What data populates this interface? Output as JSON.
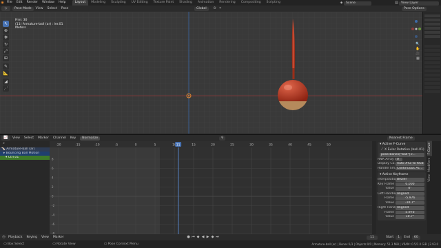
{
  "topbar": {
    "menus": [
      "File",
      "Edit",
      "Render",
      "Window",
      "Help"
    ],
    "workspaces": [
      "Layout",
      "Modeling",
      "Sculpting",
      "UV Editing",
      "Texture Paint",
      "Shading",
      "Animation",
      "Rendering",
      "Compositing",
      "Scripting"
    ],
    "active_workspace": "Layout",
    "scene": "Scene",
    "view_layer": "View Layer"
  },
  "viewport_header": {
    "mode": "Pose Mode",
    "menus": [
      "View",
      "Select",
      "Pose"
    ],
    "transform": "Global",
    "options": "Pose Options"
  },
  "viewport_overlay": {
    "line1": "Frm: 30",
    "line2": "(11) Armature-ball (ar) : ler.01",
    "line3": "Meters"
  },
  "toolbar": {
    "tools": [
      "select-box",
      "cursor",
      "move",
      "rotate",
      "scale",
      "transform",
      "annotate",
      "measure",
      "pose-relax",
      "pose-breakdown"
    ]
  },
  "graph_header": {
    "menus": [
      "View",
      "Select",
      "Marker",
      "Channel",
      "Key"
    ],
    "normalize": "Normalize",
    "snap": "Nearest Frame"
  },
  "frame_ruler": [
    "-20",
    "-15",
    "-10",
    "-5",
    "0",
    "5",
    "10",
    "15",
    "20",
    "25",
    "30",
    "35",
    "40",
    "45",
    "50"
  ],
  "current_frame": "11",
  "channels": [
    {
      "label": "Armature-ball (ar)",
      "level": 0
    },
    {
      "label": "Bouncing Ball Motion",
      "level": 1
    },
    {
      "label": "Ctrl.01",
      "level": 2
    }
  ],
  "y_ticks": [
    "8",
    "6",
    "4",
    "2",
    "0",
    "-2",
    "-4",
    "-6",
    "-8"
  ],
  "sidebar": {
    "active_fcurve": {
      "title": "Active F-Curve",
      "channel": "X Euler Rotation (ball.01)",
      "path": "pose.bones[\"ball\"].r...",
      "rna_array_index_label": "RNA Array I...",
      "rna_array_index": "0",
      "display_color_label": "Display Co...",
      "display_color": "Auto XYZ to RGB",
      "handle_smoothing_label": "Handle Sm...",
      "handle_smoothing": "Continuous Ac..."
    },
    "active_keyframe": {
      "title": "Active Keyframe",
      "interpolation_label": "Interpolation",
      "interpolation": "Bezier",
      "key_frame_label": "Key Frame",
      "key_frame": "0.000",
      "value_label": "Value",
      "value": "0°",
      "left_handle_label": "Left Handle...",
      "left_handle_type": "Aligned",
      "left_frame_label": "Frame",
      "left_frame": "-5.976",
      "left_value_label": "Value",
      "left_value": "-10.7°",
      "right_handle_label": "Right Handl...",
      "right_handle_type": "Aligned",
      "right_frame_label": "Frame",
      "right_frame": "5.976",
      "right_value_label": "Value",
      "right_value": "10.7°"
    },
    "tabs": [
      "F-Curve",
      "Modifiers",
      "View"
    ]
  },
  "playback_bar": {
    "menus": [
      "Playback",
      "Keying",
      "View",
      "Marker"
    ],
    "current_frame": "11",
    "start_label": "Start",
    "start": "1",
    "end_label": "End",
    "end": "60"
  },
  "statusbar": {
    "hint1": "Box Select",
    "hint2": "Rotate View",
    "hint3": "Pose Context Menu",
    "info": "Armature-ball (ar) | Bones:1/3 | Objects:0/0 | Memory: 51.3 MiB | VRAM: 0.5/1.0 GiB | 2.93.0"
  },
  "colors": {
    "ball_top": "#b83a23",
    "ball_bottom": "#b58a5c",
    "accent": "#4772b3",
    "playhead": "#5a8ad0",
    "curve": "#2d9d2d"
  }
}
